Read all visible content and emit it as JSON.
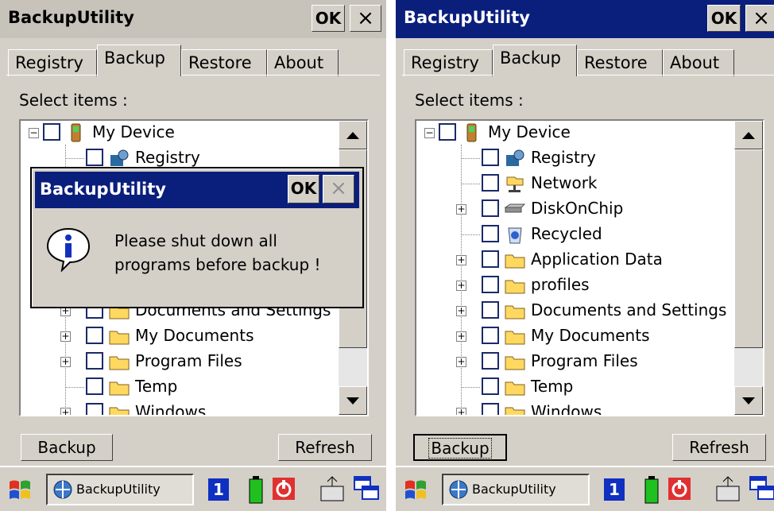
{
  "left": {
    "title": "BackupUtility",
    "ok_label": "OK",
    "close_label": "×",
    "tabs": [
      "Registry",
      "Backup",
      "Restore",
      "About"
    ],
    "select_label": "Select items :",
    "tree": {
      "root": "My Device",
      "items": [
        "Registry",
        "Documents and Settings",
        "My Documents",
        "Program Files",
        "Temp",
        "Windows"
      ]
    },
    "backup_label": "Backup",
    "refresh_label": "Refresh",
    "dialog": {
      "title": "BackupUtility",
      "ok_label": "OK",
      "close_label": "×",
      "message_line1": "Please shut down all",
      "message_line2": "programs before backup !"
    },
    "taskbar": {
      "app_label": "BackupUtility",
      "badge": "1"
    }
  },
  "right": {
    "title": "BackupUtility",
    "ok_label": "OK",
    "close_label": "×",
    "tabs": [
      "Registry",
      "Backup",
      "Restore",
      "About"
    ],
    "select_label": "Select items :",
    "tree": {
      "root": "My Device",
      "items": [
        "Registry",
        "Network",
        "DiskOnChip",
        "Recycled",
        "Application Data",
        "profiles",
        "Documents and Settings",
        "My Documents",
        "Program Files",
        "Temp",
        "Windows"
      ]
    },
    "backup_label": "Backup",
    "refresh_label": "Refresh",
    "taskbar": {
      "app_label": "BackupUtility",
      "badge": "1"
    }
  },
  "colors": {
    "title_active": "#0a1e7c",
    "title_inactive": "#c7c3bb",
    "face": "#d4d0c8"
  }
}
